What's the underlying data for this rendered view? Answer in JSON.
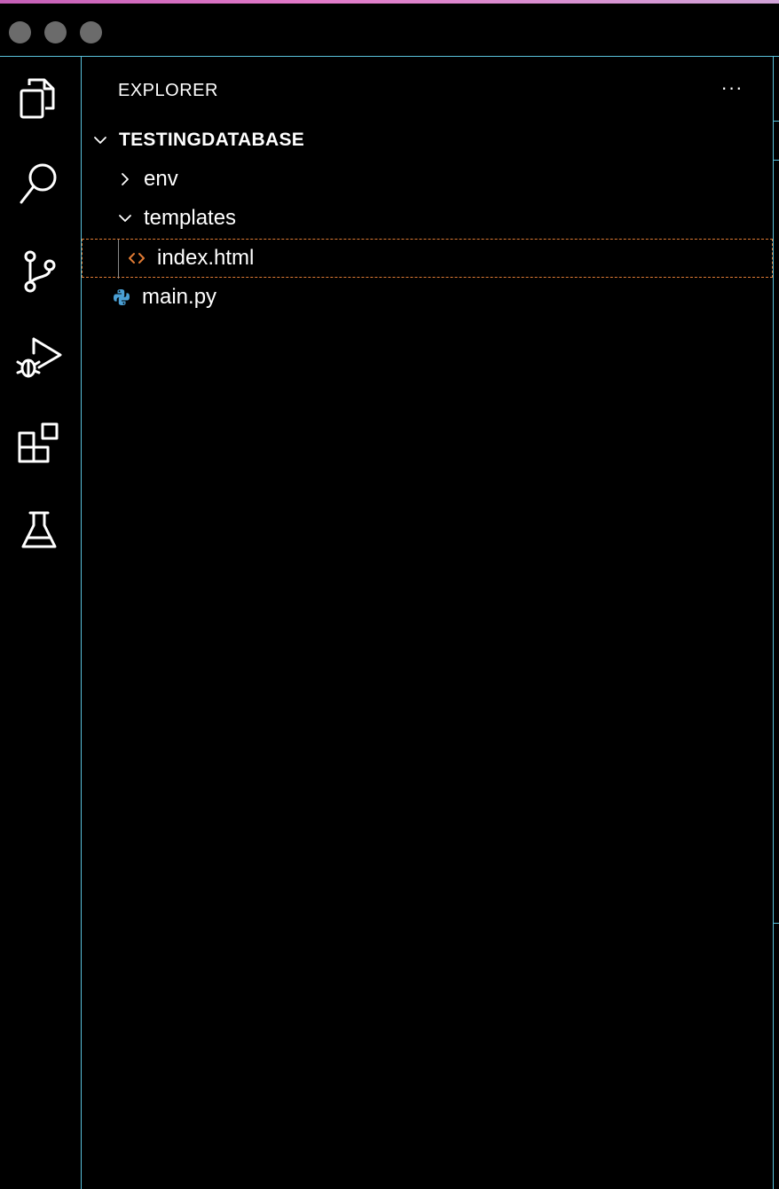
{
  "window": {
    "traffic_lights": [
      "close",
      "minimize",
      "zoom"
    ]
  },
  "activity_bar": {
    "items": [
      {
        "name": "explorer",
        "icon": "files-icon"
      },
      {
        "name": "search",
        "icon": "search-icon"
      },
      {
        "name": "source-control",
        "icon": "source-control-icon"
      },
      {
        "name": "run-and-debug",
        "icon": "run-debug-icon"
      },
      {
        "name": "extensions",
        "icon": "extensions-icon"
      },
      {
        "name": "testing",
        "icon": "flask-icon"
      }
    ]
  },
  "sidebar": {
    "title": "EXPLORER",
    "more_actions": "···",
    "root_folder": "TESTINGDATABASE",
    "tree": [
      {
        "label": "env",
        "type": "folder",
        "expanded": false
      },
      {
        "label": "templates",
        "type": "folder",
        "expanded": true
      },
      {
        "label": "index.html",
        "type": "file",
        "icon": "html-icon",
        "selected": true
      },
      {
        "label": "main.py",
        "type": "file",
        "icon": "python-icon"
      }
    ]
  },
  "colors": {
    "accent_border": "#59c2dc",
    "selection_outline": "#e07b34",
    "html_icon": "#e07b34",
    "python_icon": "#4a9fd4"
  }
}
